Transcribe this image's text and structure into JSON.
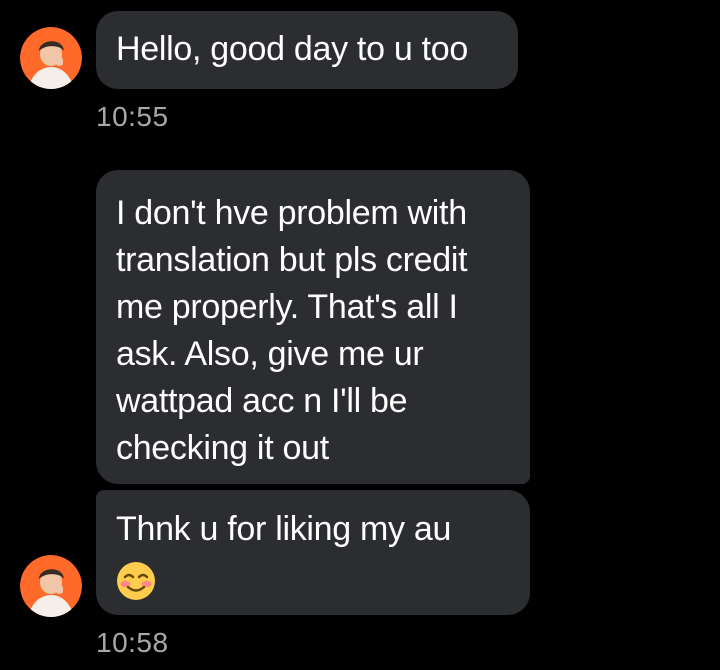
{
  "conversation": {
    "messages": [
      {
        "lines": [
          "Hello, good day to u too"
        ],
        "time": "10:55"
      },
      {
        "lines": [
          "I don't hve problem with",
          "translation but pls credit",
          "me properly. That's all I",
          "ask. Also, give me ur",
          "wattpad acc n I'll be",
          "checking it out"
        ]
      },
      {
        "lines": [
          "Thnk u for liking my au"
        ],
        "emoji": "smiling-face-with-blush",
        "time": "10:58"
      }
    ]
  },
  "colors": {
    "background": "#000000",
    "bubble": "#2c2d30",
    "timestamp": "#a7a8ab",
    "avatar_bg": "#ff6a2a",
    "emoji_face": "#ffcc4d",
    "emoji_blush": "#ff7b8f"
  },
  "icons": {
    "avatar": "contact-avatar-photo",
    "emoji": "smiling-face-with-blush-emoji"
  }
}
